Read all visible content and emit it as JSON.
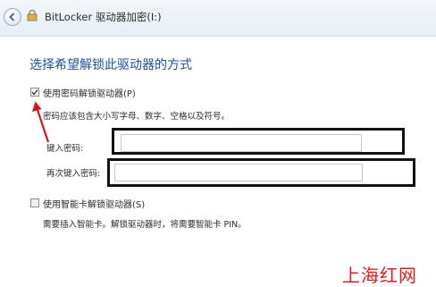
{
  "window": {
    "title": "BitLocker 驱动器加密(I:)"
  },
  "main": {
    "heading": "选择希望解锁此驱动器的方式",
    "password_option": {
      "label": "使用密码解锁驱动器(P)",
      "checked": true,
      "hint": "密码应该包含大小写字母、数字、空格以及符号。",
      "enter_password_label": "键入密码:",
      "reenter_password_label": "再次键入密码:",
      "enter_password_value": "",
      "reenter_password_value": ""
    },
    "smartcard_option": {
      "label": "使用智能卡解锁驱动器(S)",
      "checked": false,
      "hint": "需要插入智能卡。解锁驱动器时，将需要智能卡 PIN。"
    }
  },
  "watermark": {
    "text": "上海红网"
  },
  "colors": {
    "heading": "#1c4f9c",
    "annotation_arrow": "#d9161b",
    "highlight_box": "#111111",
    "watermark": "#e31b1b"
  }
}
